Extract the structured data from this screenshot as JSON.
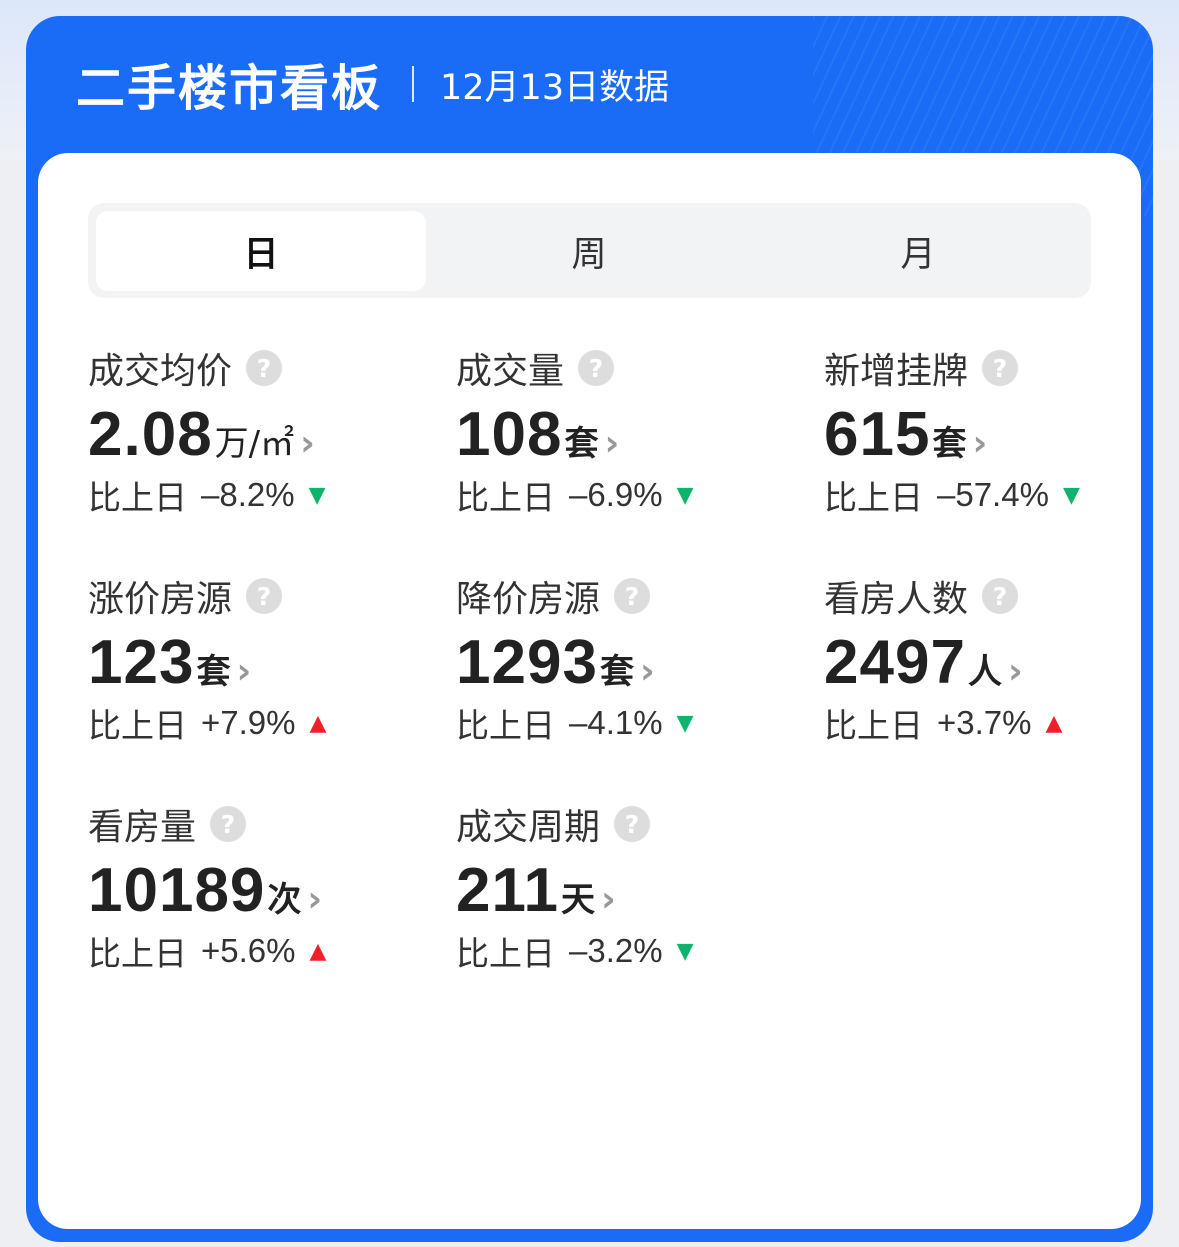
{
  "header": {
    "title": "二手楼市看板",
    "date": "12月13日数据"
  },
  "tabs": [
    {
      "label": "日",
      "active": true
    },
    {
      "label": "周",
      "active": false
    },
    {
      "label": "月",
      "active": false
    }
  ],
  "colors": {
    "brand_blue": "#1a6cf6",
    "up_red": "#f0202a",
    "down_green": "#0eb46e"
  },
  "metrics": [
    {
      "label": "成交均价",
      "value": "2.08",
      "unit": "万/㎡",
      "compare_label": "比上日",
      "change": "–8.2%",
      "trend": "down"
    },
    {
      "label": "成交量",
      "value": "108",
      "unit": "套",
      "compare_label": "比上日",
      "change": "–6.9%",
      "trend": "down"
    },
    {
      "label": "新增挂牌",
      "value": "615",
      "unit": "套",
      "compare_label": "比上日",
      "change": "–57.4%",
      "trend": "down"
    },
    {
      "label": "涨价房源",
      "value": "123",
      "unit": "套",
      "compare_label": "比上日",
      "change": "+7.9%",
      "trend": "up"
    },
    {
      "label": "降价房源",
      "value": "1293",
      "unit": "套",
      "compare_label": "比上日",
      "change": "–4.1%",
      "trend": "down"
    },
    {
      "label": "看房人数",
      "value": "2497",
      "unit": "人",
      "compare_label": "比上日",
      "change": "+3.7%",
      "trend": "up"
    },
    {
      "label": "看房量",
      "value": "10189",
      "unit": "次",
      "compare_label": "比上日",
      "change": "+5.6%",
      "trend": "up"
    },
    {
      "label": "成交周期",
      "value": "211",
      "unit": "天",
      "compare_label": "比上日",
      "change": "–3.2%",
      "trend": "down"
    }
  ],
  "icons": {
    "help": "question-circle-icon",
    "chevron": "chevron-right-icon",
    "trend_up": "triangle-up-icon",
    "trend_down": "triangle-down-icon"
  }
}
